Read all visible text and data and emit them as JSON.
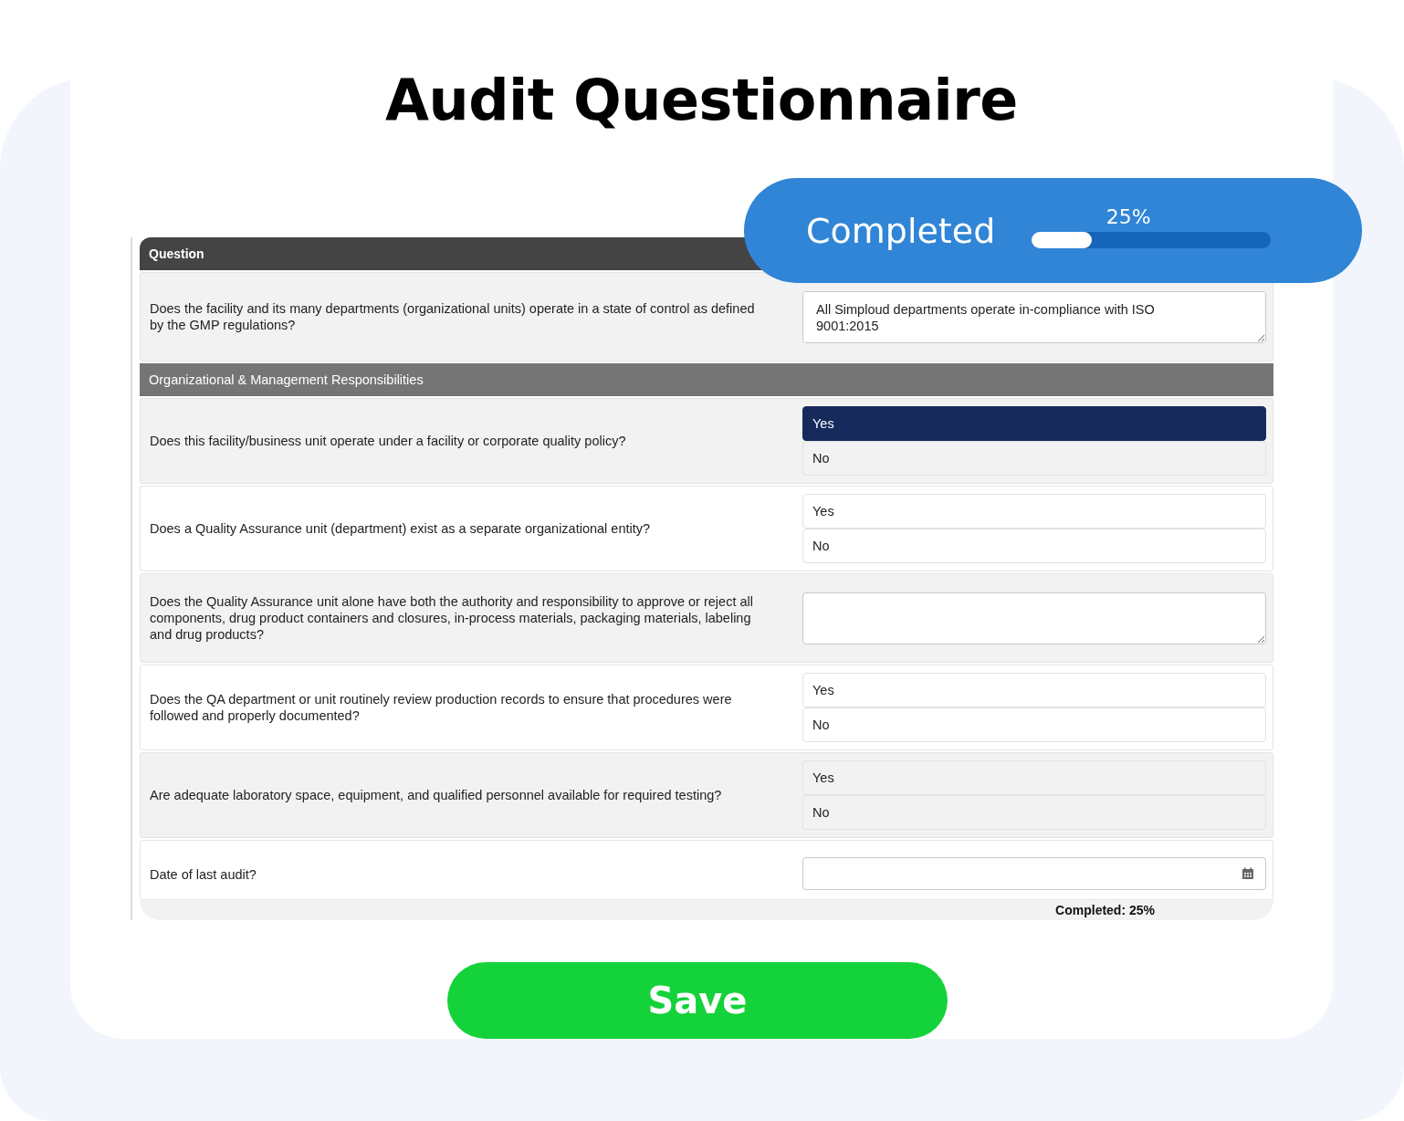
{
  "title": "Audit Questionnaire",
  "progress": {
    "label": "Completed",
    "percent": "25%",
    "level": 0.25
  },
  "table": {
    "header": "Question",
    "rows": [
      {
        "kind": "text",
        "shaded": true,
        "question": "Does the facility and its many departments (organizational units) operate in a state of control as defined by the GMP regulations?",
        "value": "All Simploud departments operate in-compliance with ISO 9001:2015"
      },
      {
        "kind": "section",
        "label": "Organizational & Management Responsibilities"
      },
      {
        "kind": "choice",
        "shaded": true,
        "question": "Does this facility/business unit operate under a facility or corporate quality policy?",
        "options": [
          {
            "label": "Yes",
            "selected": true
          },
          {
            "label": "No",
            "selected": false
          }
        ]
      },
      {
        "kind": "choice",
        "shaded": false,
        "question": "Does a Quality Assurance unit (department) exist as a separate organizational entity?",
        "options": [
          {
            "label": "Yes",
            "selected": false
          },
          {
            "label": "No",
            "selected": false
          }
        ]
      },
      {
        "kind": "text",
        "shaded": true,
        "question": "Does the Quality Assurance unit alone have both the authority and responsibility to approve or reject all components, drug product containers and closures, in-process materials, packaging materials, labeling and drug products?"
      },
      {
        "kind": "choice",
        "shaded": false,
        "question": "Does the QA department or unit routinely review production records to ensure that procedures were followed and properly documented?",
        "options": [
          {
            "label": "Yes",
            "selected": false
          },
          {
            "label": "No",
            "selected": false
          }
        ]
      },
      {
        "kind": "choice",
        "shaded": true,
        "question": "Are adequate laboratory space, equipment, and qualified personnel available for required testing?",
        "options": [
          {
            "label": "Yes",
            "selected": false
          },
          {
            "label": "No",
            "selected": false
          }
        ]
      },
      {
        "kind": "date",
        "shaded": false,
        "question": "Date of last audit?"
      }
    ]
  },
  "footer": "Completed: 25%",
  "save": "Save"
}
